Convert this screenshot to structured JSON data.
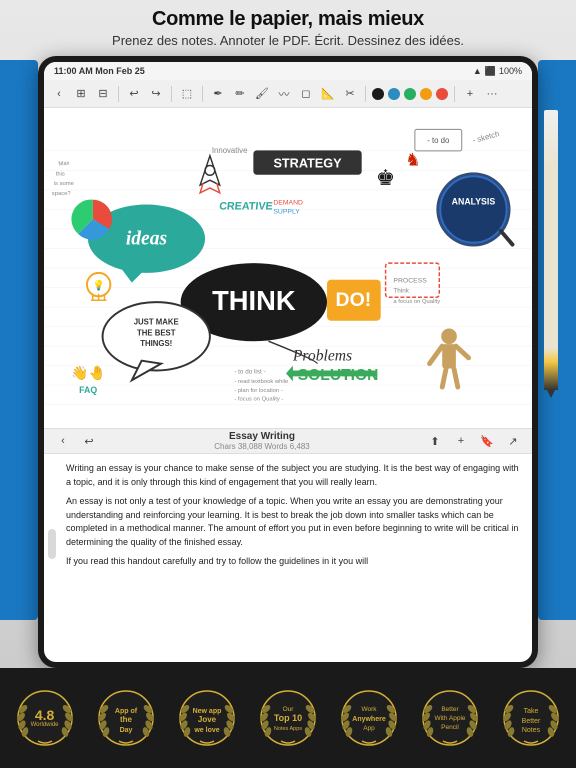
{
  "header": {
    "title": "Comme le papier, mais mieux",
    "subtitle": "Prenez des notes. Annoter le PDF. Écrit. Dessinez des idées."
  },
  "status_bar": {
    "time": "11:00 AM",
    "date": "Mon Feb 25",
    "battery": "100%",
    "wifi": true
  },
  "document": {
    "title": "Essay Writing",
    "info": "Chars 38,088 Words 6,483",
    "content_p1": "Writing an essay is your chance to make sense of the subject you are studying. It is the best way of engaging with a topic, and it is only through this kind of engagement that you will really learn.",
    "content_p2": "An essay is not only a test of your knowledge of a topic. When you write an essay you are demonstrating your understanding and reinforcing your learning. It is best to break the job down into smaller tasks which can be completed in a methodical manner. The amount of effort you put in even before beginning to write will be critical in determining the quality of the finished essay.",
    "content_p3": "If you read this handout carefully and try to follow the guidelines in it you will"
  },
  "badges": [
    {
      "id": "rating",
      "main": "4.8",
      "sub": "Worldwide"
    },
    {
      "id": "app-of-day",
      "top": "App of",
      "sub": "the Day"
    },
    {
      "id": "new-app",
      "top": "New app",
      "sub": "we love"
    },
    {
      "id": "top-notes",
      "top": "Our",
      "middle": "Top 10",
      "sub": "Notes Apps"
    },
    {
      "id": "work-anywhere",
      "top": "Work",
      "middle": "Anywhere",
      "sub": "App"
    },
    {
      "id": "better-pencil",
      "top": "Better",
      "middle": "With Apple",
      "sub": "Pencil"
    },
    {
      "id": "take-notes",
      "top": "Take",
      "middle": "Better",
      "sub": "Notes"
    }
  ],
  "toolbar": {
    "colors": [
      "#1a1a1a",
      "#2e8bc0",
      "#27ae60",
      "#f39c12",
      "#e74c3c"
    ]
  }
}
